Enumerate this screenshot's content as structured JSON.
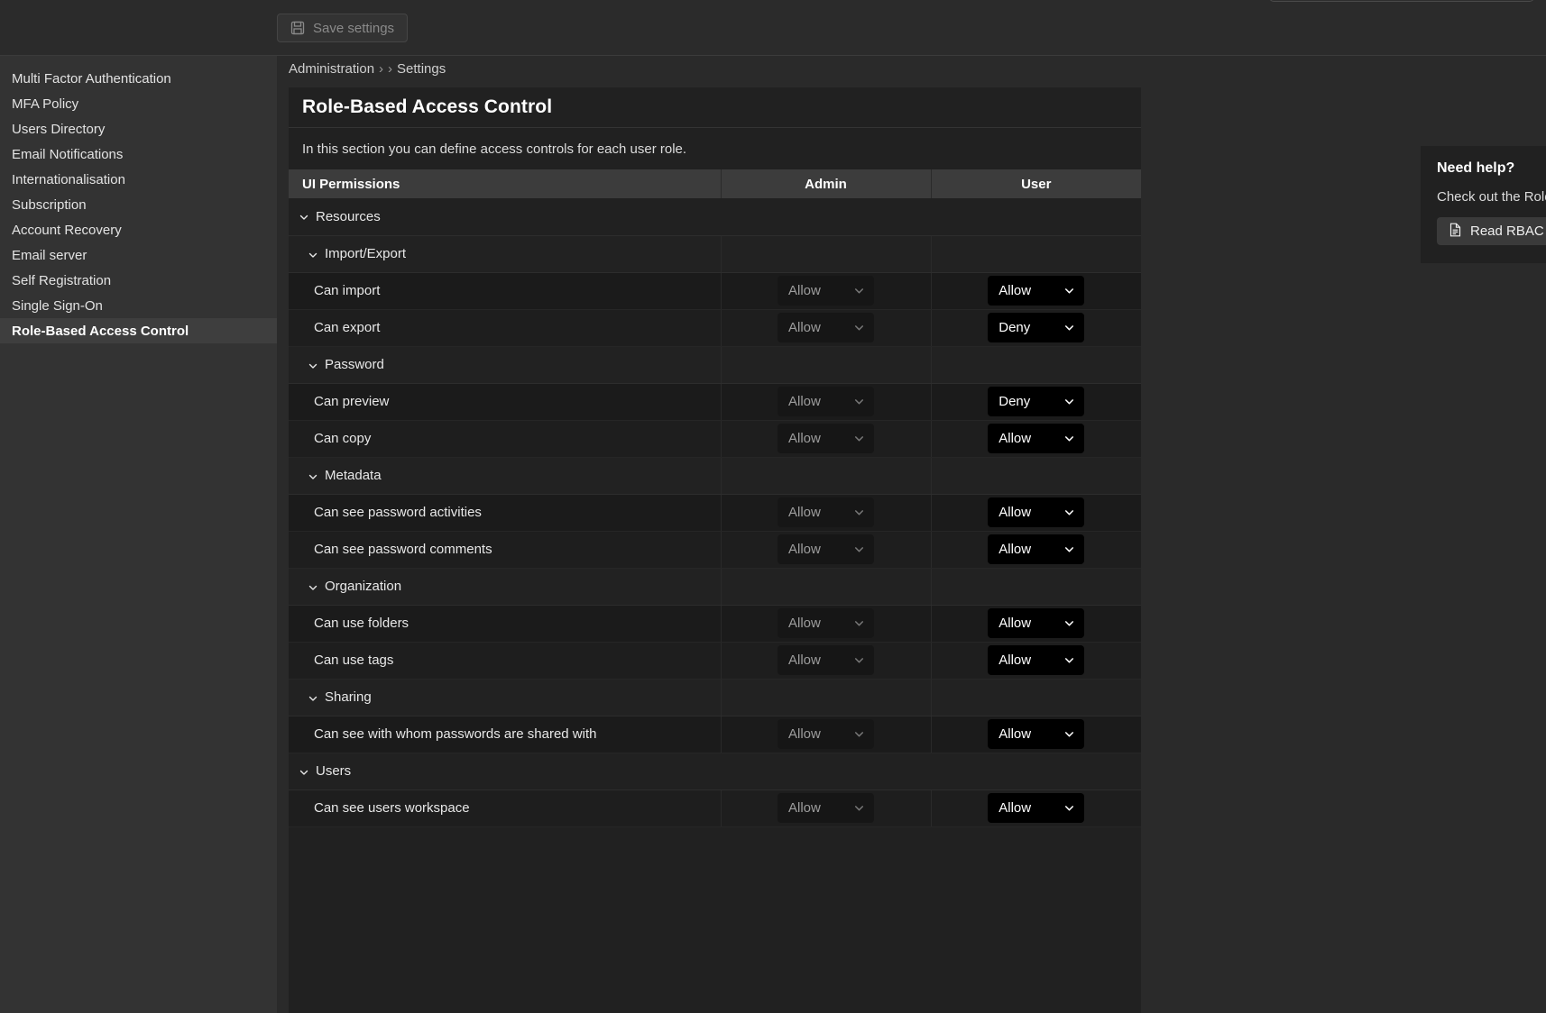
{
  "topbar": {
    "save_label": "Save settings"
  },
  "sidebar": {
    "items": [
      {
        "label": "Multi Factor Authentication",
        "active": false
      },
      {
        "label": "MFA Policy",
        "active": false
      },
      {
        "label": "Users Directory",
        "active": false
      },
      {
        "label": "Email Notifications",
        "active": false
      },
      {
        "label": "Internationalisation",
        "active": false
      },
      {
        "label": "Subscription",
        "active": false
      },
      {
        "label": "Account Recovery",
        "active": false
      },
      {
        "label": "Email server",
        "active": false
      },
      {
        "label": "Self Registration",
        "active": false
      },
      {
        "label": "Single Sign-On",
        "active": false
      },
      {
        "label": "Role-Based Access Control",
        "active": true
      }
    ]
  },
  "breadcrumb": {
    "root": "Administration",
    "sep": "›",
    "middle": "",
    "current": "Settings"
  },
  "panel": {
    "title": "Role-Based Access Control",
    "description": "In this section you can define access controls for each user role.",
    "columns": [
      "UI Permissions",
      "Admin",
      "User"
    ],
    "rows": [
      {
        "kind": "group",
        "level": 0,
        "label": "Resources"
      },
      {
        "kind": "group",
        "level": 1,
        "label": "Import/Export"
      },
      {
        "kind": "perm",
        "label": "Can import",
        "admin": "Allow",
        "user": "Allow"
      },
      {
        "kind": "perm",
        "label": "Can export",
        "admin": "Allow",
        "user": "Deny"
      },
      {
        "kind": "group",
        "level": 1,
        "label": "Password"
      },
      {
        "kind": "perm",
        "label": "Can preview",
        "admin": "Allow",
        "user": "Deny"
      },
      {
        "kind": "perm",
        "label": "Can copy",
        "admin": "Allow",
        "user": "Allow"
      },
      {
        "kind": "group",
        "level": 1,
        "label": "Metadata"
      },
      {
        "kind": "perm",
        "label": "Can see password activities",
        "admin": "Allow",
        "user": "Allow"
      },
      {
        "kind": "perm",
        "label": "Can see password comments",
        "admin": "Allow",
        "user": "Allow"
      },
      {
        "kind": "group",
        "level": 1,
        "label": "Organization"
      },
      {
        "kind": "perm",
        "label": "Can use folders",
        "admin": "Allow",
        "user": "Allow"
      },
      {
        "kind": "perm",
        "label": "Can use tags",
        "admin": "Allow",
        "user": "Allow"
      },
      {
        "kind": "group",
        "level": 1,
        "label": "Sharing"
      },
      {
        "kind": "perm",
        "label": "Can see with whom passwords are shared with",
        "admin": "Allow",
        "user": "Allow"
      },
      {
        "kind": "group",
        "level": 0,
        "label": "Users"
      },
      {
        "kind": "perm",
        "label": "Can see users workspace",
        "admin": "Allow",
        "user": "Allow"
      }
    ],
    "select_options": [
      "Allow",
      "Deny"
    ]
  },
  "help": {
    "title": "Need help?",
    "text": "Check out the Role Based Access Control documentation.",
    "button_label": "Read RBAC doc"
  },
  "icons": {
    "save": "save-icon",
    "chevron_down": "chevron-down-icon",
    "document": "document-icon"
  },
  "colors": {
    "app_bg": "#2a2a2a",
    "sidebar_bg": "#333333",
    "panel_bg": "#212121",
    "table_header_bg": "#3c3c3c",
    "select_enabled_bg": "#000000",
    "select_disabled_bg": "#161616",
    "active_item_bg": "#3e3e3e"
  }
}
